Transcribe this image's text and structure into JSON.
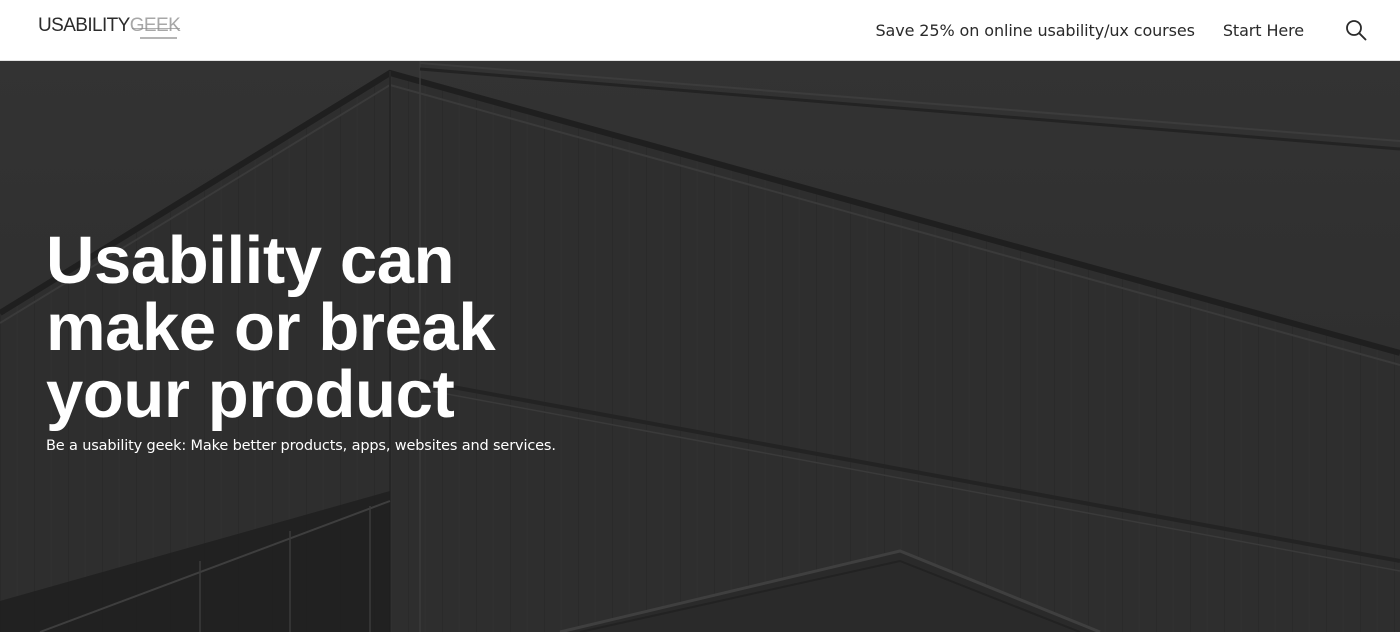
{
  "header": {
    "logo": {
      "main": "USABILITY",
      "accent": "GEEK"
    },
    "nav": {
      "promo_label": "Save 25% on online usability/ux courses",
      "start_label": "Start Here",
      "search_icon": "search-icon"
    }
  },
  "hero": {
    "title": "Usability can make or break your product",
    "subtitle": "Be a usability geek: Make better products, apps, websites and services."
  },
  "colors": {
    "header_bg": "#ffffff",
    "hero_bg": "#2c2c2c",
    "hero_text": "#ffffff",
    "nav_text": "#2a2a2a",
    "logo_main": "#2b2b2b",
    "logo_accent": "#a7a7a7"
  }
}
